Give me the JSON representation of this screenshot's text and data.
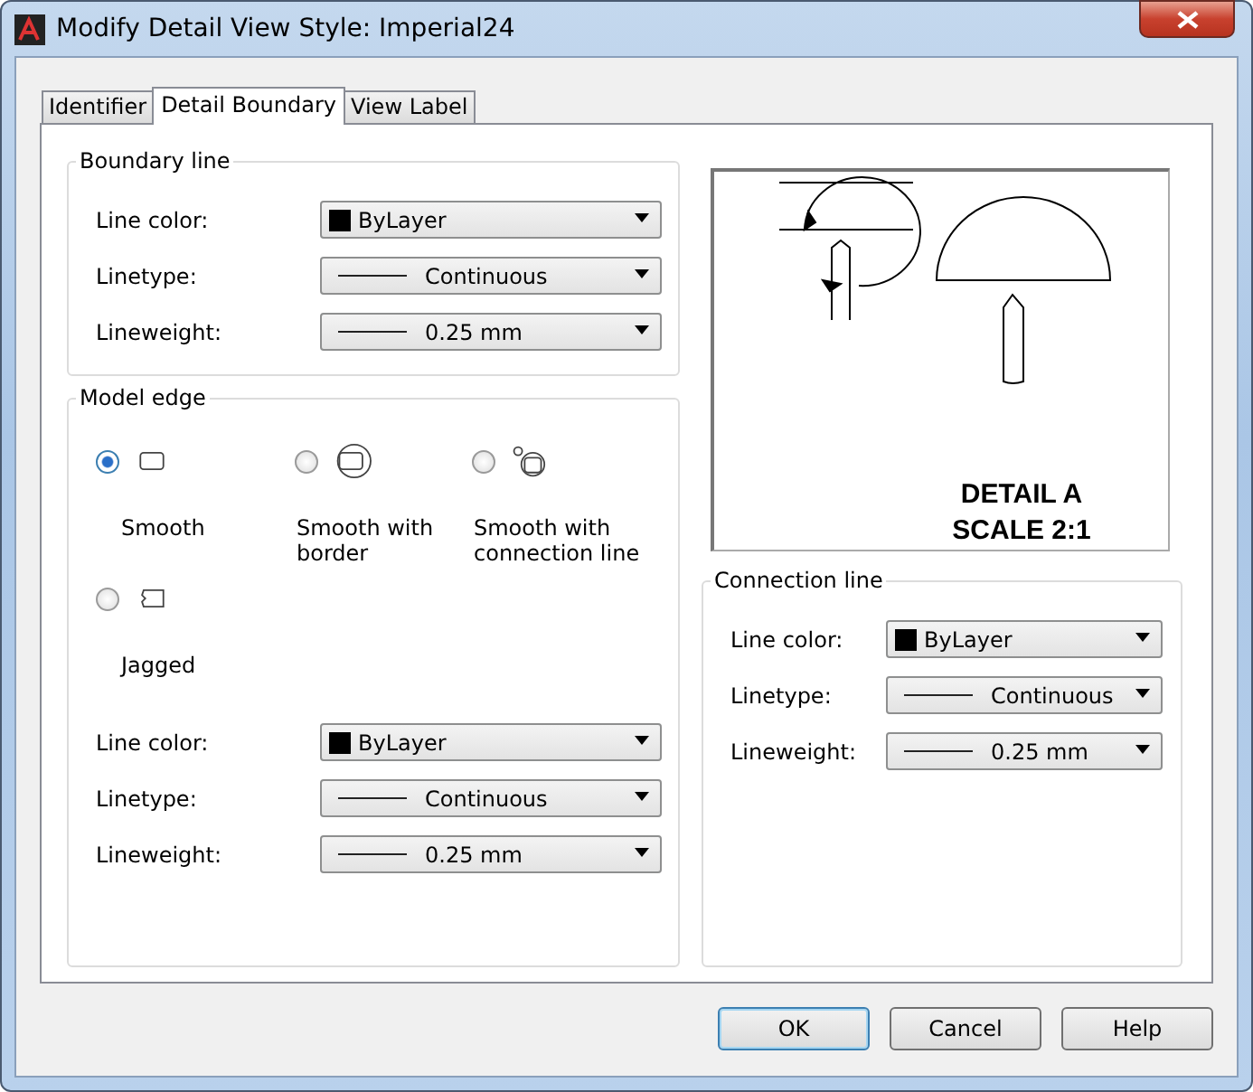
{
  "window": {
    "title": "Modify Detail View Style: Imperial24"
  },
  "tabs": [
    {
      "label": "Identifier",
      "selected": false
    },
    {
      "label": "Detail Boundary",
      "selected": true
    },
    {
      "label": "View Label",
      "selected": false
    }
  ],
  "boundary_line": {
    "title": "Boundary line",
    "fields": [
      {
        "label": "Line color:",
        "kind": "color",
        "value": "ByLayer"
      },
      {
        "label": "Linetype:",
        "kind": "linetype",
        "value": "Continuous"
      },
      {
        "label": "Lineweight:",
        "kind": "lineweight",
        "value": "0.25 mm"
      }
    ]
  },
  "model_edge": {
    "title": "Model edge",
    "options": [
      {
        "label": "Smooth",
        "kind": "smooth",
        "selected": true
      },
      {
        "label": "Smooth with border",
        "kind": "border",
        "selected": false
      },
      {
        "label": "Smooth with connection line",
        "kind": "connection",
        "selected": false
      },
      {
        "label": "Jagged",
        "kind": "jagged",
        "selected": false
      }
    ],
    "fields": [
      {
        "label": "Line color:",
        "kind": "color",
        "value": "ByLayer"
      },
      {
        "label": "Linetype:",
        "kind": "linetype",
        "value": "Continuous"
      },
      {
        "label": "Lineweight:",
        "kind": "lineweight",
        "value": "0.25 mm"
      }
    ]
  },
  "preview": {
    "label_lines": [
      "DETAIL A",
      "SCALE 2:1"
    ]
  },
  "connection_line": {
    "title": "Connection line",
    "fields": [
      {
        "label": "Line color:",
        "kind": "color",
        "value": "ByLayer"
      },
      {
        "label": "Linetype:",
        "kind": "linetype",
        "value": "Continuous"
      },
      {
        "label": "Lineweight:",
        "kind": "lineweight",
        "value": "0.25 mm"
      }
    ]
  },
  "buttons": [
    {
      "label": "OK",
      "kind": "default"
    },
    {
      "label": "Cancel",
      "kind": "normal"
    },
    {
      "label": "Help",
      "kind": "normal"
    }
  ]
}
